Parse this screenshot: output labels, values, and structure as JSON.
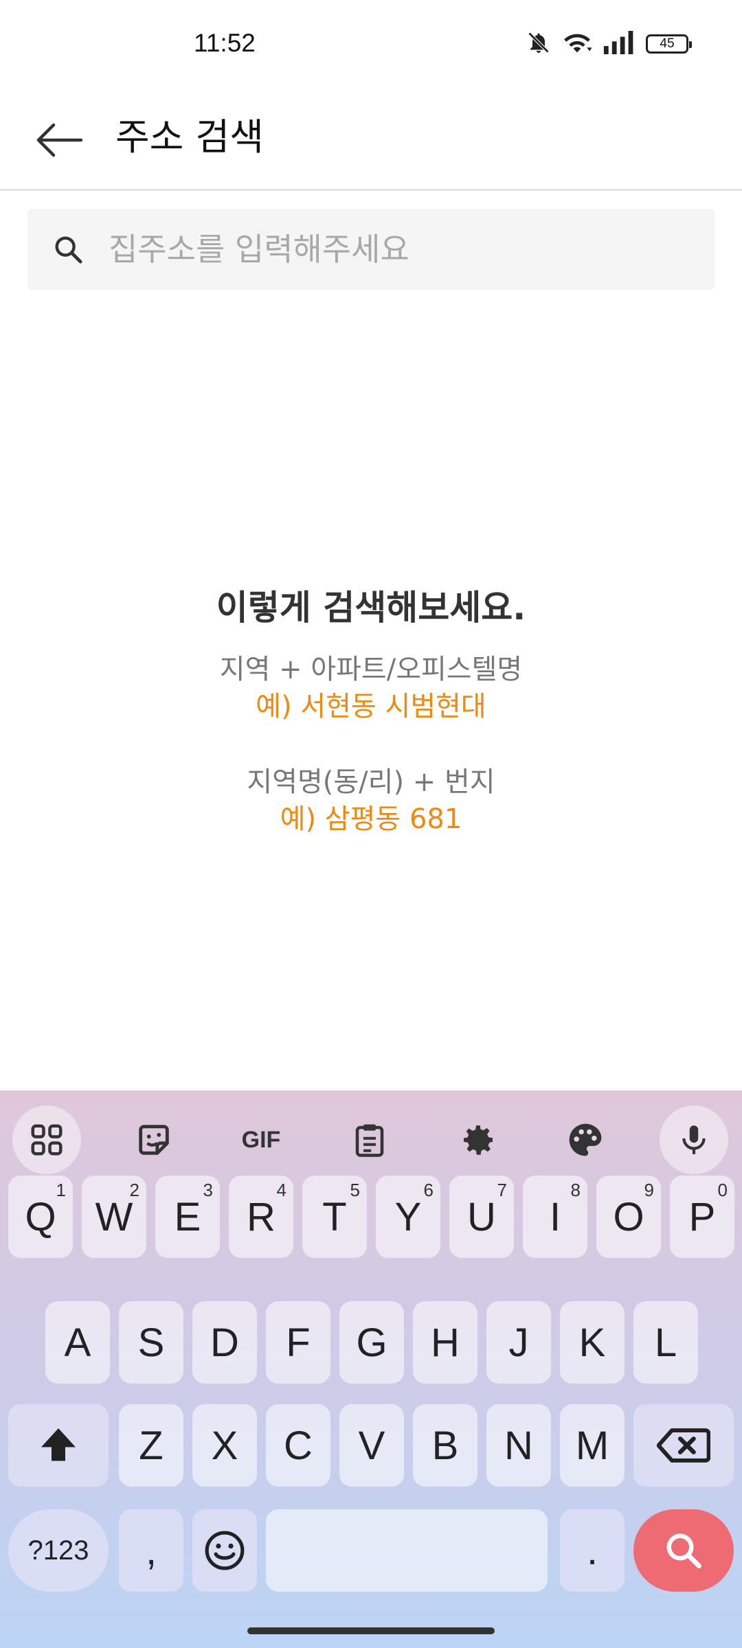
{
  "status": {
    "time": "11:52",
    "battery": "45"
  },
  "header": {
    "title": "주소 검색"
  },
  "search": {
    "placeholder": "집주소를 입력해주세요",
    "value": ""
  },
  "guide": {
    "heading": "이렇게 검색해보세요.",
    "hint1": "지역 + 아파트/오피스텔명",
    "example1": "예) 서현동 시범현대",
    "hint2": "지역명(동/리) + 번지",
    "example2": "예) 삼평동 681"
  },
  "keyboard": {
    "toolbar": [
      "grid-icon",
      "sticker-icon",
      "gif-icon",
      "clipboard-icon",
      "settings-icon",
      "palette-icon",
      "microphone-icon"
    ],
    "gif_label": "GIF",
    "row1": [
      {
        "key": "Q",
        "hint": "1"
      },
      {
        "key": "W",
        "hint": "2"
      },
      {
        "key": "E",
        "hint": "3"
      },
      {
        "key": "R",
        "hint": "4"
      },
      {
        "key": "T",
        "hint": "5"
      },
      {
        "key": "Y",
        "hint": "6"
      },
      {
        "key": "U",
        "hint": "7"
      },
      {
        "key": "I",
        "hint": "8"
      },
      {
        "key": "O",
        "hint": "9"
      },
      {
        "key": "P",
        "hint": "0"
      }
    ],
    "row2": [
      "A",
      "S",
      "D",
      "F",
      "G",
      "H",
      "J",
      "K",
      "L"
    ],
    "row3": [
      "Z",
      "X",
      "C",
      "V",
      "B",
      "N",
      "M"
    ],
    "symbols_label": "?123",
    "comma": ",",
    "period": ".",
    "accent_color": "#ee6b73"
  },
  "colors": {
    "example_text": "#ee8a12"
  }
}
